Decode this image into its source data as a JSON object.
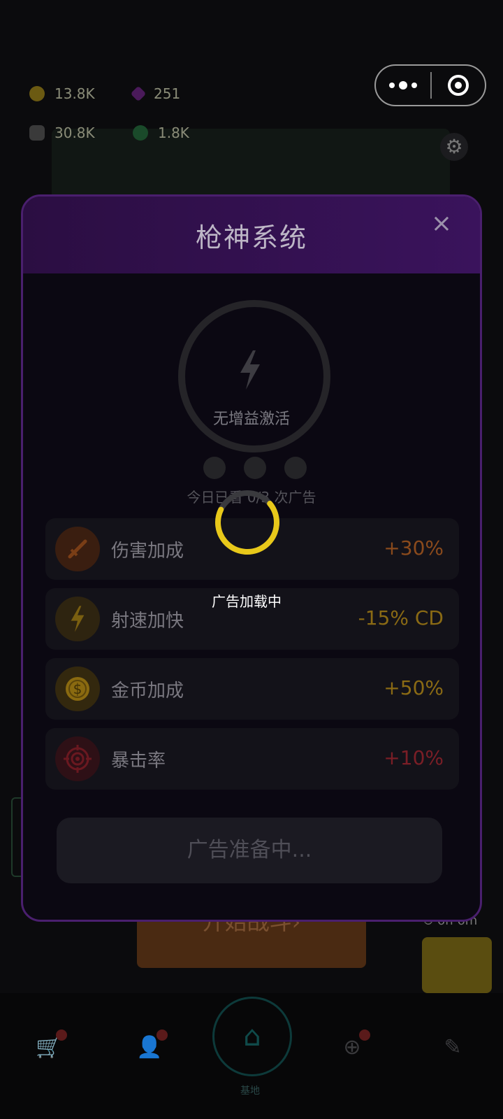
{
  "resources": [
    {
      "name": "coin",
      "value": "13.8K",
      "color": "#6b5a12"
    },
    {
      "name": "gem",
      "value": "251",
      "color": "#4a1a5a"
    },
    {
      "name": "shield",
      "value": "30.8K",
      "color": "#3a3a3a"
    },
    {
      "name": "token",
      "value": "1.8K",
      "color": "#1a4a2a"
    }
  ],
  "background": {
    "start_button": "开始战斗",
    "start_arrow": "›",
    "timer": "6h 6m",
    "home_label": "基地"
  },
  "modal": {
    "title": "枪神系统",
    "close": "×",
    "boost_status": "无增益激活",
    "watched_text": "今日已看 0/3 次广告",
    "rows": [
      {
        "label": "伤害加成",
        "value": "+30%",
        "value_color": "#8a4a1c",
        "icon": "sword-icon",
        "icon_bg": "#3a1e10",
        "icon_color": "#7a3e16"
      },
      {
        "label": "射速加快",
        "value": "-15% CD",
        "value_color": "#8a6a14",
        "icon": "lightning-icon",
        "icon_bg": "#2e2410",
        "icon_color": "#7a5f10"
      },
      {
        "label": "金币加成",
        "value": "+50%",
        "value_color": "#8a6a14",
        "icon": "dollar-coin-icon",
        "icon_bg": "#33280e",
        "icon_color": "#8a6a10"
      },
      {
        "label": "暴击率",
        "value": "+10%",
        "value_color": "#7a1e26",
        "icon": "target-icon",
        "icon_bg": "#2e1016",
        "icon_color": "#6a1820"
      }
    ],
    "ad_button": "广告准备中..."
  },
  "loading": {
    "text": "广告加载中",
    "spinner_color": "#e8c81a"
  }
}
